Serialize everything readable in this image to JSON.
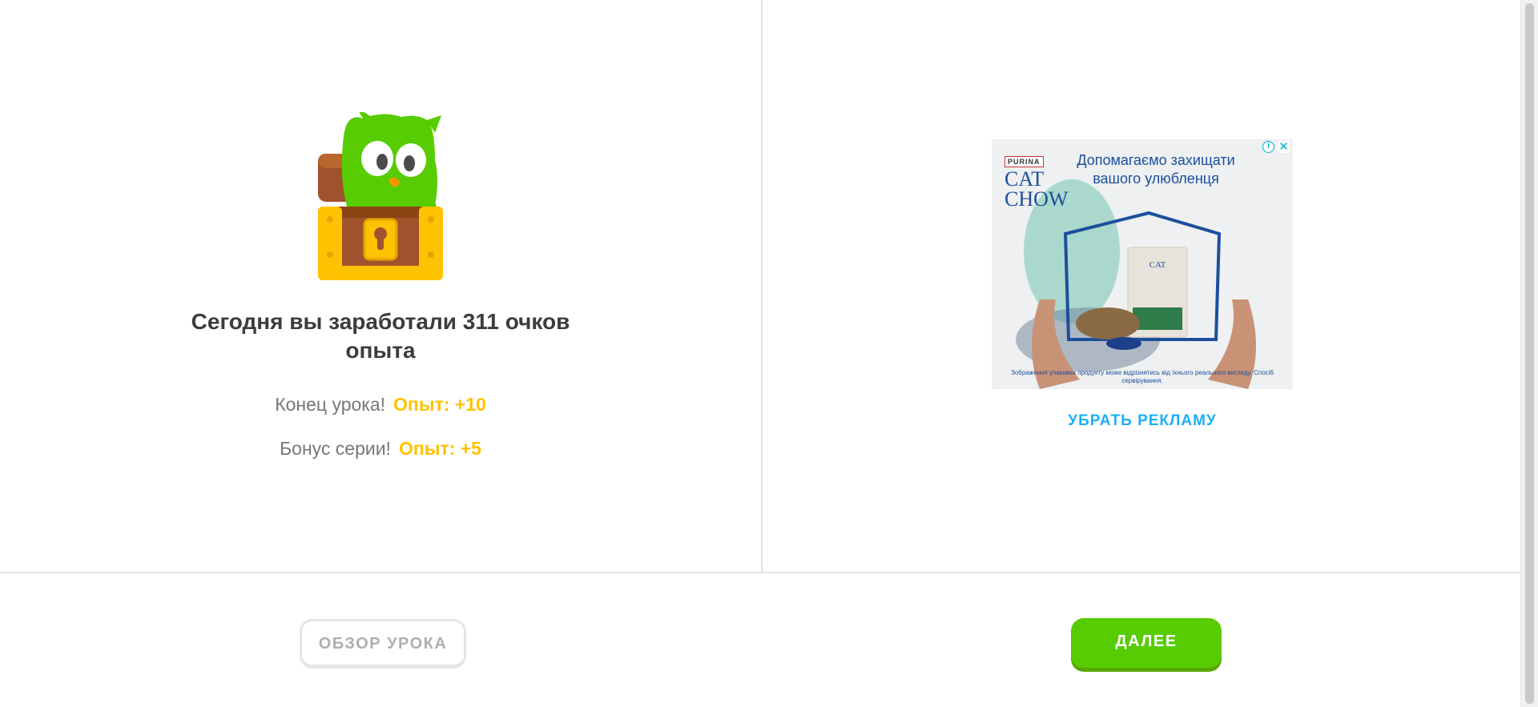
{
  "lesson_complete": {
    "headline": "Сегодня вы заработали 311 очков опыта",
    "rows": [
      {
        "label": "Конец урока!",
        "value": "Опыт: +10"
      },
      {
        "label": "Бонус серии!",
        "value": "Опыт: +5"
      }
    ]
  },
  "ad": {
    "brand_top": "PURINA",
    "brand_line1": "CAT",
    "brand_line2": "CHOW",
    "headline": "Допомагаємо захищати вашого улюбленця",
    "disclaimer": "Зображення упаковки продукту може відрізнятись від їхнього реального вигляду. Спосіб сервірування.",
    "info_icon": "i",
    "close_icon": "✕",
    "remove_ads_label": "УБРАТЬ РЕКЛАМУ"
  },
  "footer": {
    "review_label": "ОБЗОР УРОКА",
    "continue_label": "ДАЛЕЕ"
  },
  "colors": {
    "xp_accent": "#ffc200",
    "continue_green": "#58cc02",
    "link_blue": "#1cb0f6",
    "headline_text": "#3c3c3c",
    "muted_text": "#777777"
  },
  "icons": {
    "mascot": "owl-in-treasure-chest-icon"
  }
}
